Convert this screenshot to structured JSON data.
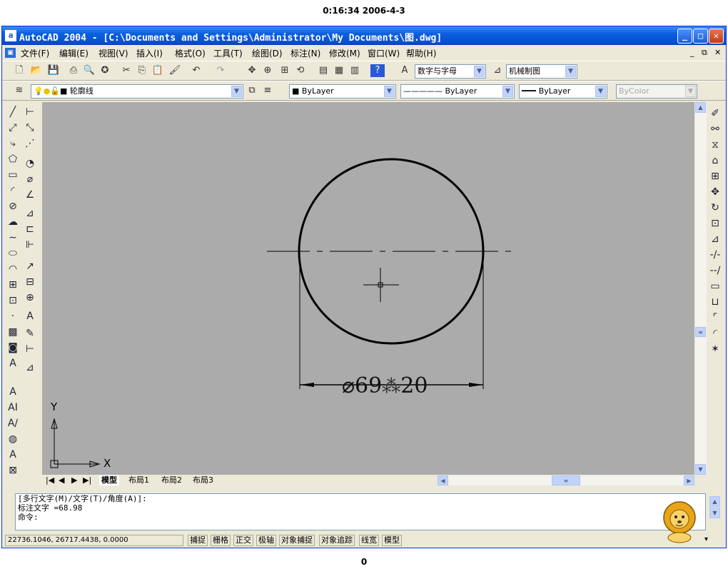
{
  "caption_top": "0:16:34 2006-4-3",
  "caption_bottom": "0",
  "window": {
    "title": "AutoCAD 2004 - [C:\\Documents and Settings\\Administrator\\My Documents\\图.dwg]",
    "app_icon": "a",
    "buttons": {
      "minimize": "_",
      "maximize": "□",
      "close": "✕"
    }
  },
  "menu": {
    "items": [
      "文件(F)",
      "编辑(E)",
      "视图(V)",
      "插入(I)",
      "格式(O)",
      "工具(T)",
      "绘图(D)",
      "标注(N)",
      "修改(M)",
      "窗口(W)",
      "帮助(H)"
    ],
    "doc_controls": {
      "minimize": "_",
      "restore": "⧉",
      "close": "✕"
    }
  },
  "standard_toolbar": {
    "text_style": "数字与字母",
    "dim_style": "机械制图"
  },
  "layers_toolbar": {
    "current_layer": "轮廓线",
    "color": "ByLayer",
    "linetype": "ByLayer",
    "lineweight": "ByLayer",
    "plot_style": "ByColor"
  },
  "drawing": {
    "dimension_text": "⌀69",
    "dimension_suffix": "20",
    "ucs_x": "X",
    "ucs_y": "Y"
  },
  "tabs": {
    "model": "模型",
    "layout1": "布局1",
    "layout2": "布局2",
    "layout3": "布局3"
  },
  "command_window": {
    "line1": "[多行文字(M)/文字(T)/角度(A)]:",
    "line2": "标注文字 =68.98",
    "line3": "命令:"
  },
  "status_bar": {
    "coordinates": "22736.1046, 26717.4438, 0.0000",
    "toggles": [
      "捕捉",
      "栅格",
      "正交",
      "极轴",
      "对象捕捉",
      "对象追踪",
      "线宽",
      "模型"
    ]
  },
  "colors": {
    "titlebar": "#0a5fe0",
    "chrome": "#ece9d8",
    "canvas": "#ababab"
  }
}
